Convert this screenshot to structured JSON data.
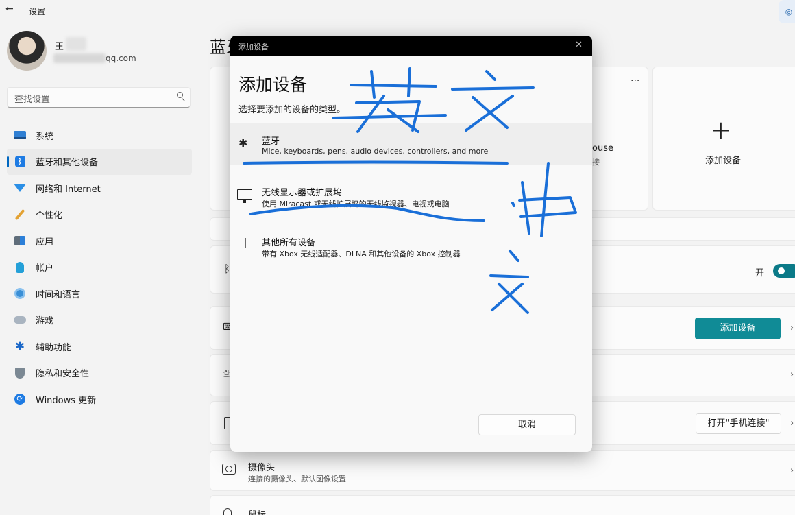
{
  "window": {
    "title": "设置",
    "back_glyph": "←",
    "minimize_glyph": "—"
  },
  "profile": {
    "name": "王",
    "email_suffix": "qq.com"
  },
  "search": {
    "placeholder": "查找设置"
  },
  "nav": {
    "items": [
      {
        "label": "系统",
        "icon": "system-icon"
      },
      {
        "label": "蓝牙和其他设备",
        "icon": "bluetooth-icon",
        "active": true
      },
      {
        "label": "网络和 Internet",
        "icon": "network-icon"
      },
      {
        "label": "个性化",
        "icon": "brush-icon"
      },
      {
        "label": "应用",
        "icon": "apps-icon"
      },
      {
        "label": "帐户",
        "icon": "account-icon"
      },
      {
        "label": "时间和语言",
        "icon": "time-language-icon"
      },
      {
        "label": "游戏",
        "icon": "gaming-icon"
      },
      {
        "label": "辅助功能",
        "icon": "accessibility-icon"
      },
      {
        "label": "隐私和安全性",
        "icon": "shield-icon"
      },
      {
        "label": "Windows 更新",
        "icon": "update-icon"
      }
    ]
  },
  "main": {
    "title": "蓝牙和其他设备",
    "device_tile": {
      "name_fragment": "ouse",
      "sub_fragment": "接",
      "more": "···"
    },
    "add_tile": {
      "plus": "+",
      "label": "添加设备"
    },
    "bluetooth_row": {
      "toggle_label": "开",
      "toggle_on": true
    },
    "devices_row": {
      "button": "添加设备"
    },
    "phone_row": {
      "button": "打开\"手机连接\""
    },
    "camera_row": {
      "title": "摄像头",
      "subtitle": "连接的摄像头、默认图像设置"
    },
    "mouse_row": {
      "title": "鼠标"
    },
    "chevron": "›"
  },
  "dialog": {
    "bar_title": "添加设备",
    "close_glyph": "✕",
    "heading": "添加设备",
    "subheading": "选择要添加的设备的类型。",
    "options": [
      {
        "title": "蓝牙",
        "desc": "Mice, keyboards, pens, audio devices, controllers, and more",
        "icon": "bluetooth-icon",
        "glyph": "✱"
      },
      {
        "title": "无线显示器或扩展坞",
        "desc": "使用 Miracast 或无线扩展坞的无线监视器、电视或电脑",
        "icon": "monitor-icon"
      },
      {
        "title": "其他所有设备",
        "desc": "带有 Xbox 无线适配器、DLNA 和其他设备的 Xbox 控制器",
        "icon": "plus-icon",
        "glyph": "+"
      }
    ],
    "cancel": "取消"
  },
  "colors": {
    "accent": "#108b96",
    "nav_accent": "#0067c0",
    "scribble": "#1a6fd8"
  }
}
